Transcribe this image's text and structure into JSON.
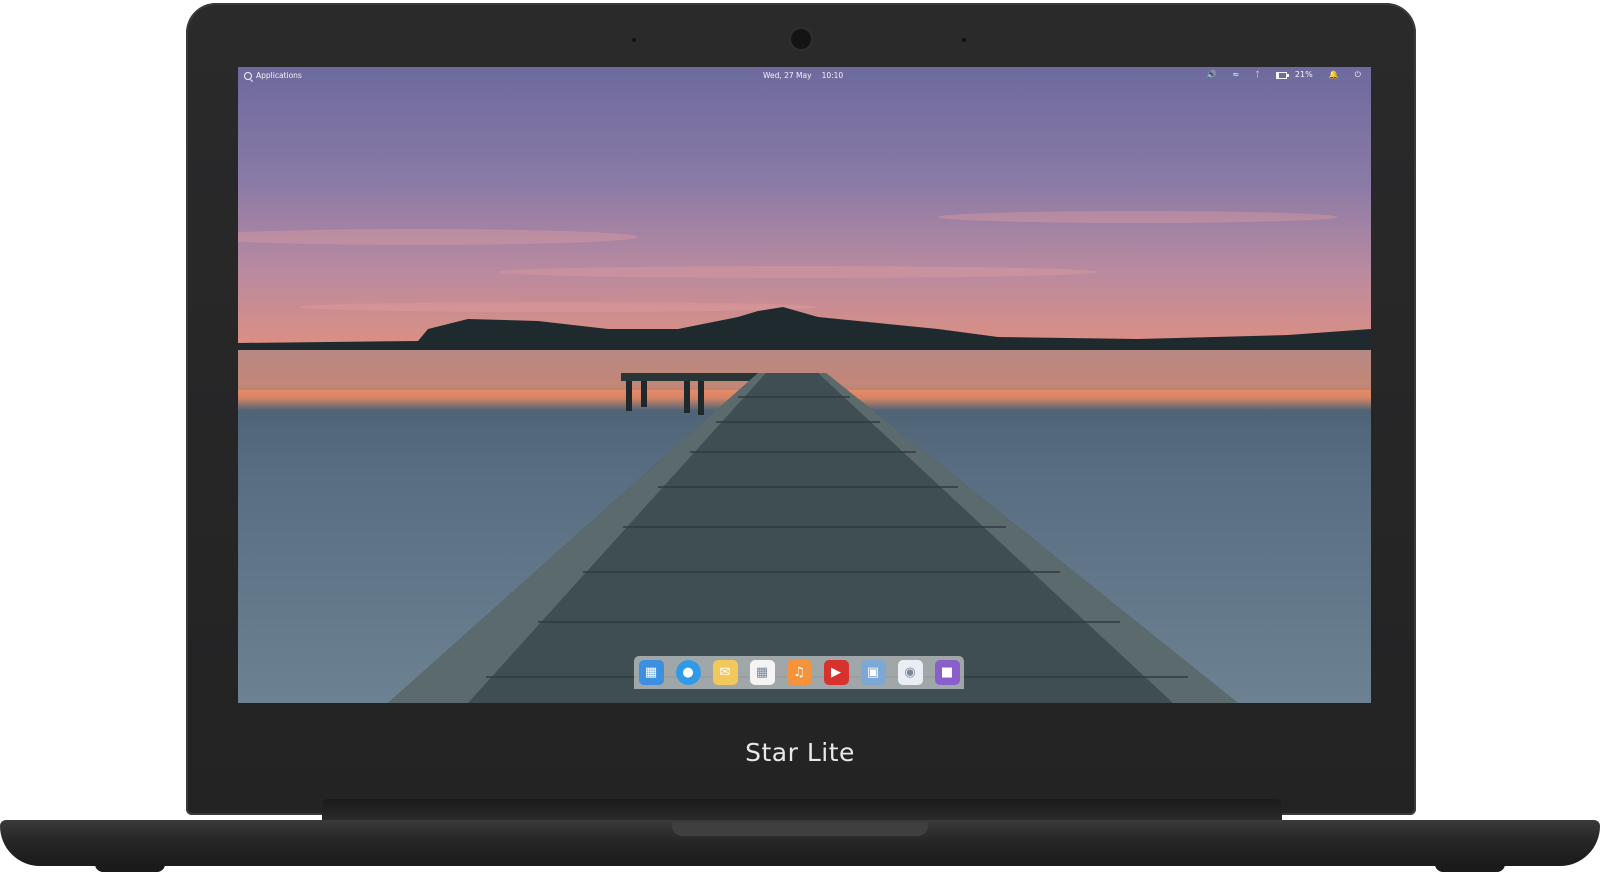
{
  "device": {
    "brand_label": "Star Lite"
  },
  "top_panel": {
    "applications_label": "Applications",
    "date": "Wed, 27 May",
    "time": "10:10",
    "battery_percent": "21%",
    "battery_level": 0.21,
    "indicators": [
      "volume-icon",
      "wifi-icon",
      "bluetooth-icon",
      "battery-icon",
      "notifications-icon",
      "power-icon"
    ]
  },
  "dock": {
    "apps": [
      {
        "name": "multitasking-view-icon",
        "color": "#3d8fe0"
      },
      {
        "name": "web-browser-icon",
        "color": "#2f9be8"
      },
      {
        "name": "mail-icon",
        "color": "#f3c85a"
      },
      {
        "name": "calendar-icon",
        "color": "#f4f4f4"
      },
      {
        "name": "music-icon",
        "color": "#f5923a"
      },
      {
        "name": "videos-icon",
        "color": "#d8322e"
      },
      {
        "name": "photos-icon",
        "color": "#7da8d6"
      },
      {
        "name": "settings-icon",
        "color": "#e8eef4"
      },
      {
        "name": "appcenter-icon",
        "color": "#8b5fc9"
      }
    ]
  },
  "colors": {
    "bezel": "#252526",
    "sky_top": "#6d6a9d",
    "horizon": "#f08e69",
    "water": "#5a7083"
  }
}
